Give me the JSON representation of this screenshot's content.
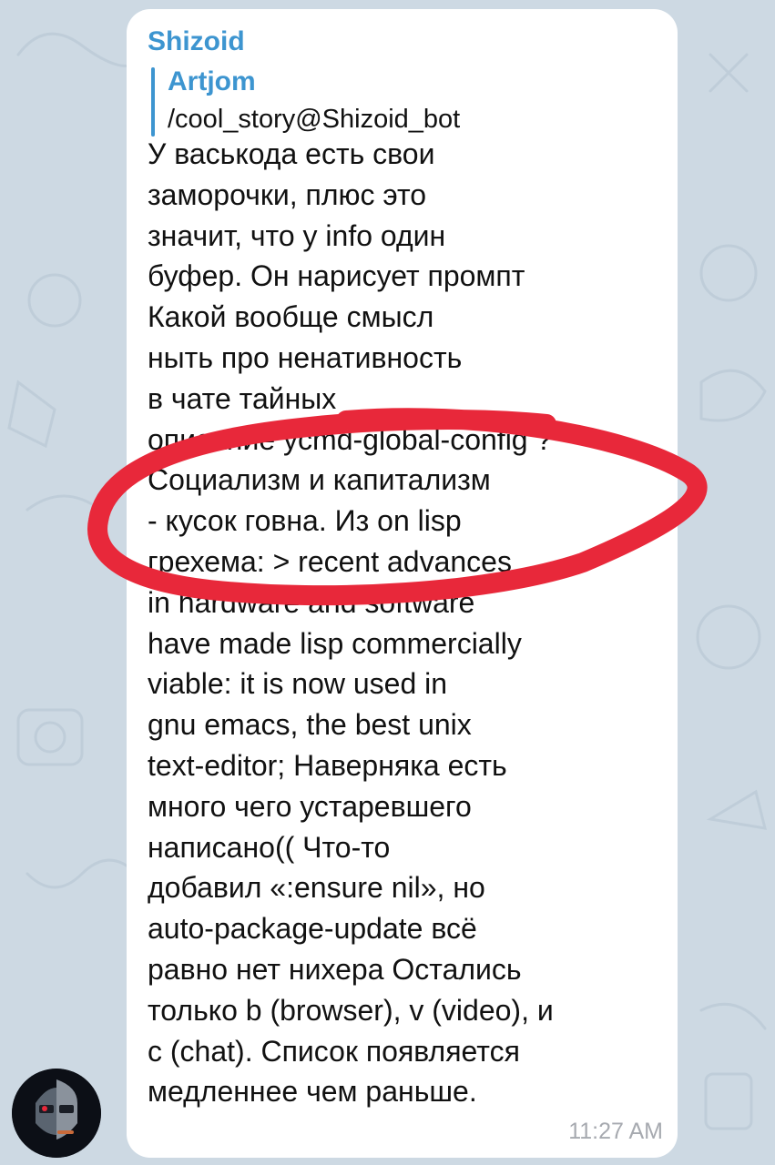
{
  "message": {
    "sender": "Shizoid",
    "reply": {
      "author": "Artjom",
      "text": "/cool_story@Shizoid_bot"
    },
    "lines": [
      "У васькода есть свои",
      "заморочки, плюс это",
      "значит, что у info один",
      "буфер. Он нарисует промпт",
      "Какой вообще смысл",
      "ныть про ненативность",
      "в чате тайных",
      "описание ycmd-global-config ?",
      "Социализм и капитализм",
      "- кусок говна. Из on lisp",
      "грехема: > recent advances",
      "in hardware and software",
      "have made lisp commercially",
      "viable: it is now used in",
      "gnu emacs, the best unix",
      "text-editor; Наверняка есть",
      "много чего устаревшего",
      "написано(( Что-то",
      "добавил «:ensure nil», но",
      "auto-package-update всё",
      "равно нет нихера Остались",
      "только b (browser), v (video), и",
      "c (chat). Список появляется",
      "медленнее чем раньше."
    ],
    "time": "11:27 AM"
  },
  "colors": {
    "chat_background": "#cdd9e3",
    "bubble": "#ffffff",
    "accent": "#3d95d0",
    "annotation": "#e8283a",
    "timestamp": "#a7aab0"
  },
  "icons": {
    "avatar": "robot-face-avatar",
    "annotation": "red-freehand-circle"
  }
}
